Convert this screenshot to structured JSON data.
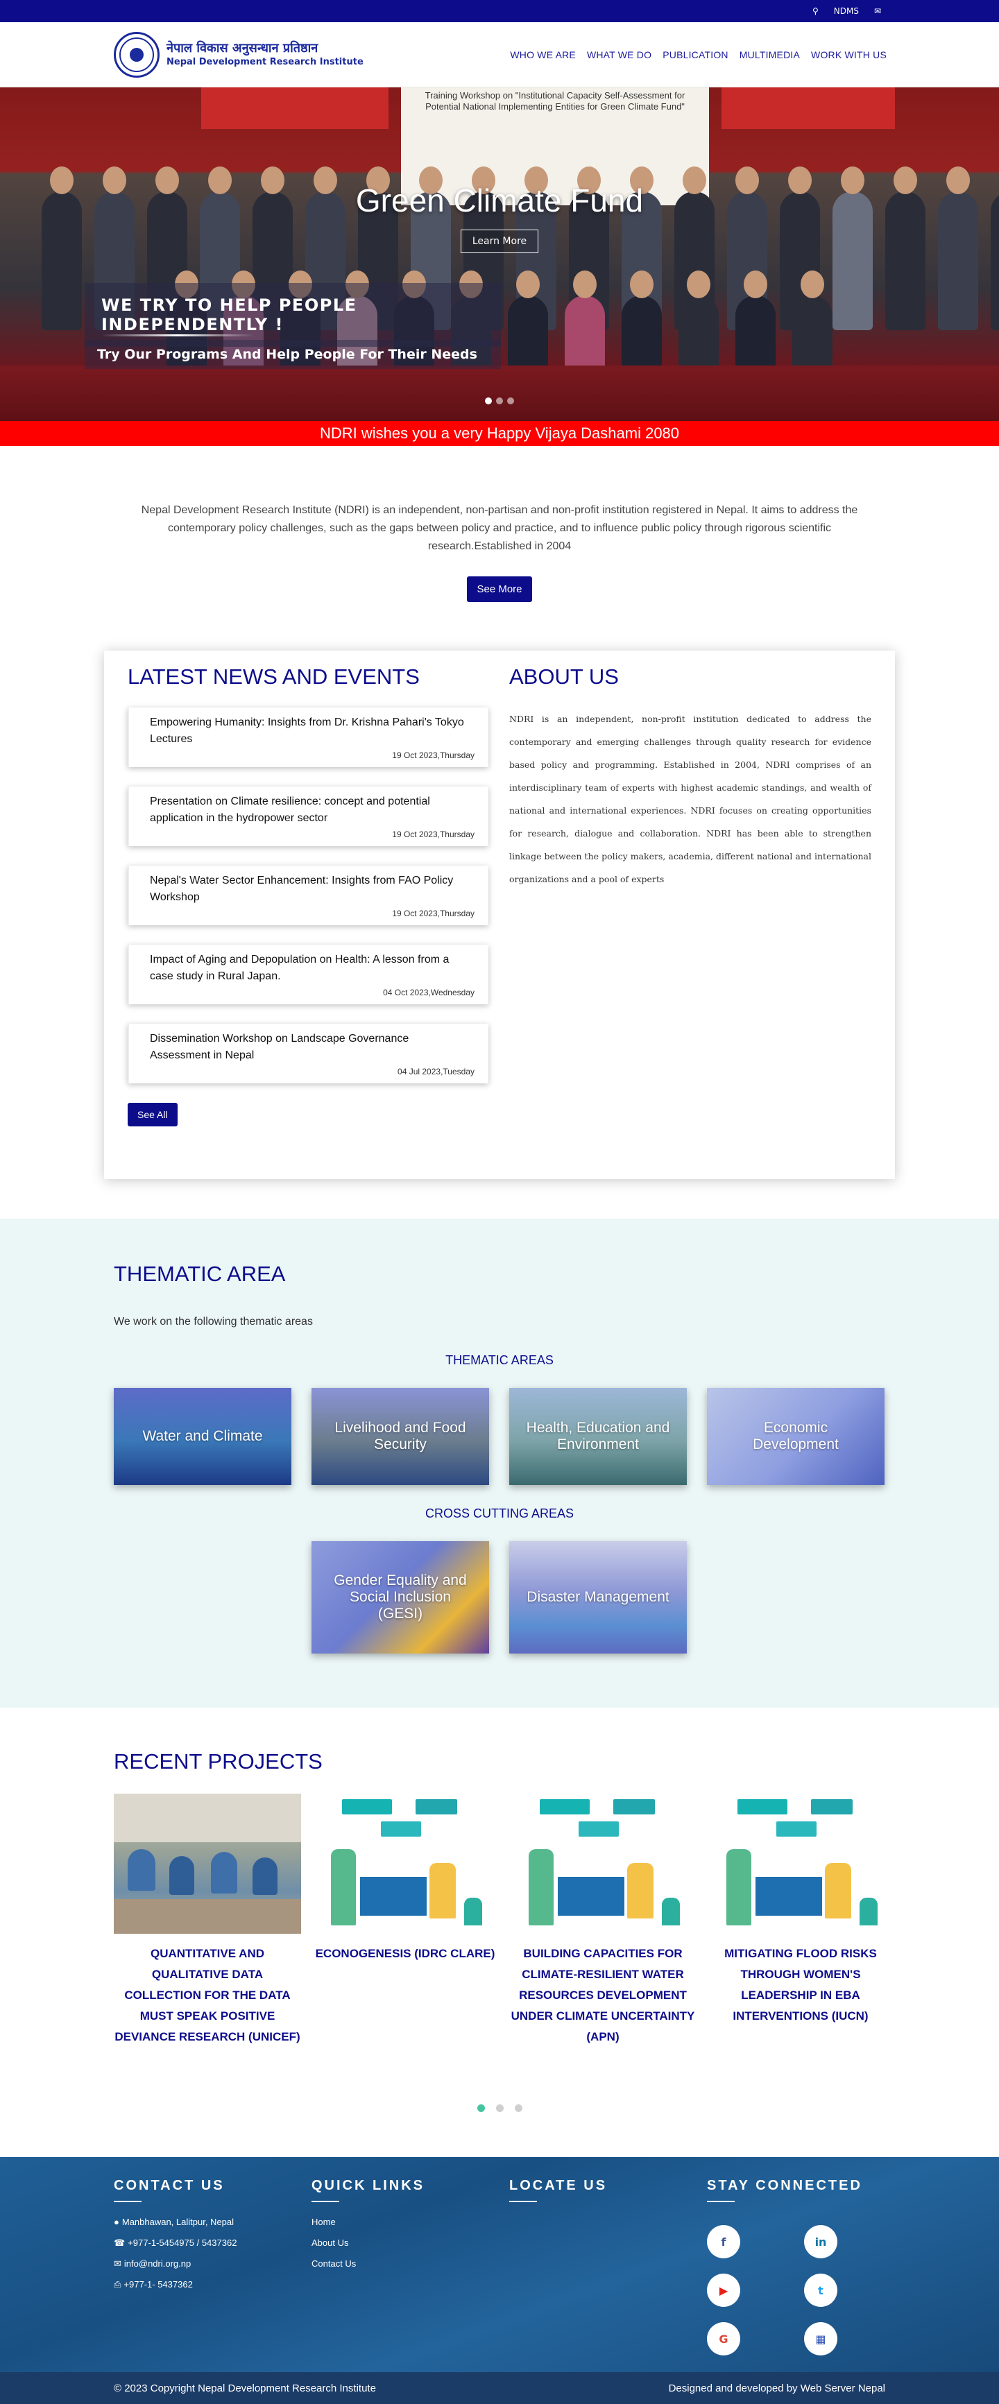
{
  "topbar": {
    "search_icon": "search-icon",
    "ndms_label": "NDMS",
    "mail_icon": "mail-icon"
  },
  "header": {
    "logo_nepali": "नेपाल विकास अनुसन्धान प्रतिष्ठान",
    "logo_english": "Nepal Development Research Institute",
    "nav": [
      "WHO WE ARE",
      "WHAT WE DO",
      "PUBLICATION",
      "MULTIMEDIA",
      "WORK WITH US"
    ]
  },
  "hero": {
    "banner_title": "Training Workshop on \"Institutional Capacity Self-Assessment for Potential National Implementing Entities for Green Climate Fund\"",
    "title": "Green Climate Fund",
    "button": "Learn More",
    "heading": "WE TRY TO HELP PEOPLE INDEPENDENTLY !",
    "subheading": "Try Our Programs And Help People For Their Needs",
    "active_slide": 1,
    "slide_count": 3
  },
  "marquee": "NDRI wishes you a very Happy Vijaya Dashami 2080",
  "intro": {
    "text": "Nepal Development Research Institute (NDRI) is an independent, non-partisan and non-profit institution registered in Nepal. It aims to address the contemporary policy challenges, such as the gaps between policy and practice, and to influence public policy through rigorous scientific research.Established in 2004",
    "button": "See More"
  },
  "news": {
    "title": "LATEST NEWS AND EVENTS",
    "items": [
      {
        "title": "Empowering Humanity: Insights from Dr. Krishna Pahari's Tokyo Lectures",
        "date": "19 Oct 2023,Thursday"
      },
      {
        "title": "Presentation on Climate resilience: concept and potential application in the hydropower sector",
        "date": "19 Oct 2023,Thursday"
      },
      {
        "title": "Nepal's Water Sector Enhancement: Insights from FAO Policy Workshop",
        "date": "19 Oct 2023,Thursday"
      },
      {
        "title": "Impact of Aging and Depopulation on Health: A lesson from a case study in Rural Japan.",
        "date": "04 Oct 2023,Wednesday"
      },
      {
        "title": "Dissemination Workshop on Landscape Governance Assessment in Nepal",
        "date": "04 Jul 2023,Tuesday"
      }
    ],
    "see_all": "See All"
  },
  "about": {
    "title": "ABOUT US",
    "text": "NDRI is an independent, non-profit institution dedicated to address the contemporary and emerging challenges through quality research for evidence based policy and programming. Established in 2004, NDRI comprises of an interdisciplinary team of experts with highest academic standings, and wealth of national and international experiences. NDRI focuses on creating opportunities for research, dialogue and collaboration. NDRI has been able to strengthen linkage between the policy makers, academia, different national and international organizations and a pool of experts"
  },
  "thematic": {
    "title": "THEMATIC AREA",
    "subtitle": "We work on the following thematic areas",
    "areas_heading": "THEMATIC AREAS",
    "areas": [
      "Water and Climate",
      "Livelihood and Food Security",
      "Health, Education and Environment",
      "Economic Development"
    ],
    "cross_heading": "CROSS CUTTING AREAS",
    "cross": [
      "Gender Equality and Social Inclusion (GESI)",
      "Disaster Management"
    ]
  },
  "projects": {
    "title": "RECENT PROJECTS",
    "items": [
      "QUANTITATIVE AND QUALITATIVE DATA COLLECTION FOR THE DATA MUST SPEAK POSITIVE DEVIANCE RESEARCH (UNICEF)",
      "ECONOGENESIS (IDRC CLARE)",
      "BUILDING CAPACITIES FOR CLIMATE-RESILIENT WATER RESOURCES DEVELOPMENT UNDER CLIMATE UNCERTAINTY (APN)",
      "MITIGATING FLOOD RISKS THROUGH WOMEN'S LEADERSHIP IN EBA INTERVENTIONS (IUCN)"
    ],
    "active_page": 1,
    "page_count": 3
  },
  "footer": {
    "contact_title": "CONTACT US",
    "address": "Manbhawan, Lalitpur, Nepal",
    "phone": "+977-1-5454975 / 5437362",
    "email": "info@ndri.org.np",
    "fax": "+977-1- 5437362",
    "links_title": "QUICK LINKS",
    "links": [
      "Home",
      "About Us",
      "Contact Us"
    ],
    "locate_title": "LOCATE US",
    "social_title": "STAY CONNECTED",
    "social_icons": [
      "facebook-icon",
      "linkedin-icon",
      "youtube-icon",
      "twitter-icon",
      "google-icon",
      "microsoft-icon"
    ],
    "copyright": "© 2023 Copyright Nepal Development Research Institute",
    "credit": "Designed and developed by Web Server Nepal"
  },
  "colors": {
    "brand_blue": "#0d0d8c",
    "marquee_red": "#ff0000",
    "thematic_bg": "#ebf6f6",
    "footer_blue": "#1f5f96"
  }
}
